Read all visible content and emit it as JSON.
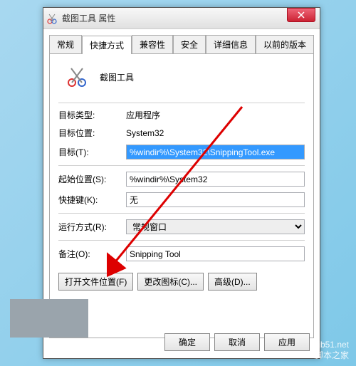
{
  "window": {
    "title": "截图工具 属性"
  },
  "tabs": {
    "items": [
      "常规",
      "快捷方式",
      "兼容性",
      "安全",
      "详细信息",
      "以前的版本"
    ],
    "activeIndex": 1
  },
  "app": {
    "name": "截图工具"
  },
  "fields": {
    "targetType": {
      "label": "目标类型:",
      "value": "应用程序"
    },
    "targetLoc": {
      "label": "目标位置:",
      "value": "System32"
    },
    "target": {
      "label": "目标(T):",
      "value": "%windir%\\System32\\SnippingTool.exe"
    },
    "startIn": {
      "label": "起始位置(S):",
      "value": "%windir%\\System32"
    },
    "shortcut": {
      "label": "快捷键(K):",
      "value": "无"
    },
    "run": {
      "label": "运行方式(R):",
      "value": "常规窗口"
    },
    "comment": {
      "label": "备注(O):",
      "value": "Snipping Tool"
    }
  },
  "buttons": {
    "openLoc": "打开文件位置(F)",
    "changeIcon": "更改图标(C)...",
    "advanced": "高级(D)...",
    "ok": "确定",
    "cancel": "取消",
    "apply": "应用"
  },
  "watermark": {
    "url": "jb51.net",
    "name": "脚本之家"
  }
}
